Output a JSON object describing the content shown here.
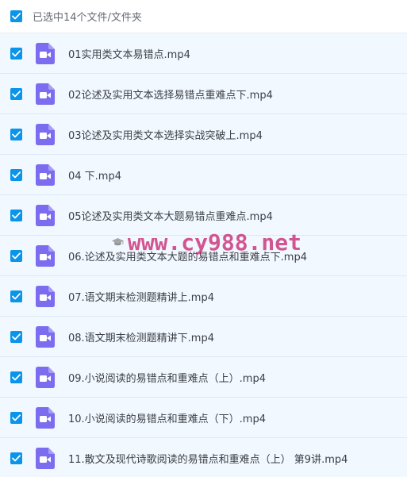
{
  "header": {
    "label": "已选中14个文件/文件夹",
    "checked": true
  },
  "files": [
    {
      "name": "01实用类文本易错点.mp4",
      "checked": true
    },
    {
      "name": "02论述及实用文本选择易错点重难点下.mp4",
      "checked": true
    },
    {
      "name": "03论述及实用类文本选择实战突破上.mp4",
      "checked": true
    },
    {
      "name": "04 下.mp4",
      "checked": true
    },
    {
      "name": "05论述及实用类文本大题易错点重难点.mp4",
      "checked": true
    },
    {
      "name": "06.论述及实用类文本大题的易错点和重难点下.mp4",
      "checked": true
    },
    {
      "name": "07.语文期末检测题精讲上.mp4",
      "checked": true
    },
    {
      "name": "08.语文期末检测题精讲下.mp4",
      "checked": true
    },
    {
      "name": "09.小说阅读的易错点和重难点（上）.mp4",
      "checked": true
    },
    {
      "name": "10.小说阅读的易错点和重难点（下）.mp4",
      "checked": true
    },
    {
      "name": "11.散文及现代诗歌阅读的易错点和重难点（上） 第9讲.mp4",
      "checked": true
    }
  ],
  "watermark": {
    "text": "www.cy988.net"
  },
  "colors": {
    "checkbox": "#0a94ea",
    "row_bg": "#f2f8ff",
    "video_icon": "#7b6cf0",
    "watermark": "#c71f6b"
  },
  "icons": {
    "checkbox": "check-icon",
    "file": "video-file-icon"
  }
}
